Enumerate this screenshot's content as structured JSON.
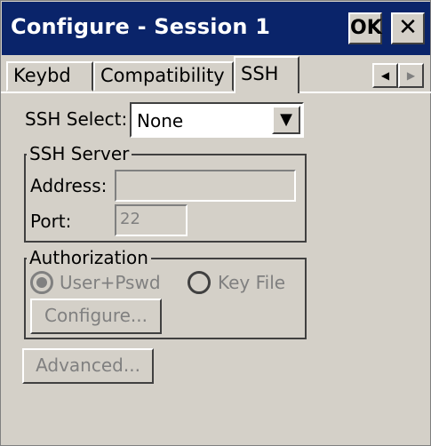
{
  "window": {
    "title": "Configure - Session 1",
    "ok_label": "OK",
    "close_label": "✕"
  },
  "tabs": [
    {
      "label": "Keybd",
      "selected": false
    },
    {
      "label": "Compatibility",
      "selected": false
    },
    {
      "label": "SSH",
      "selected": true
    }
  ],
  "tab_scroll": {
    "left": "◀",
    "right": "▶"
  },
  "ssh_select": {
    "label": "SSH Select:",
    "value": "None",
    "arrow": "▼"
  },
  "ssh_server": {
    "title": "SSH Server",
    "address_label": "Address:",
    "address_value": "",
    "port_label": "Port:",
    "port_value": "22"
  },
  "authorization": {
    "title": "Authorization",
    "radio_user": "User+Pswd",
    "radio_keyfile": "Key File",
    "selected": "User+Pswd",
    "configure_label": "Configure..."
  },
  "advanced_label": "Advanced...",
  "colors": {
    "titlebar": "#0a246a",
    "face": "#d4d0c8",
    "disabled_text": "#808080"
  }
}
